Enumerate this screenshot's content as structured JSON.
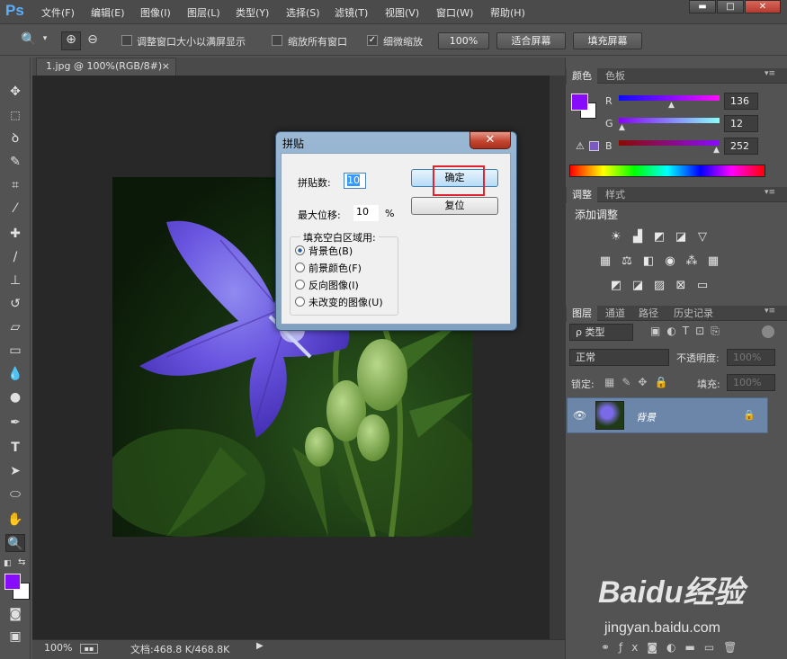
{
  "app": {
    "logo": "Ps"
  },
  "menus": [
    "文件(F)",
    "编辑(E)",
    "图像(I)",
    "图层(L)",
    "类型(Y)",
    "选择(S)",
    "滤镜(T)",
    "视图(V)",
    "窗口(W)",
    "帮助(H)"
  ],
  "window_controls": {
    "minimize": "▬",
    "maximize": "□",
    "close": "✕"
  },
  "options": {
    "resize_windows": "调整窗口大小以满屏显示",
    "zoom_all": "缩放所有窗口",
    "scrubby_zoom": "细微缩放",
    "scrubby_checked": "✓",
    "zoom_100": "100%",
    "fit_screen": "适合屏幕",
    "fill_screen": "填充屏幕"
  },
  "document": {
    "tab_title": "1.jpg @ 100%(RGB/8#)",
    "tab_close": "×"
  },
  "status": {
    "zoom": "100%",
    "doc_size": "文档:468.8 K/468.8K"
  },
  "dialog": {
    "title": "拼贴",
    "close": "✕",
    "tiles_label": "拼贴数:",
    "tiles_value": "10",
    "offset_label": "最大位移:",
    "offset_value": "10",
    "offset_unit": "%",
    "group_label": "填充空白区域用:",
    "options": [
      "背景色(B)",
      "前景颜色(F)",
      "反向图像(I)",
      "未改变的图像(U)"
    ],
    "selected_index": 0,
    "ok": "确定",
    "reset": "复位"
  },
  "color_panel": {
    "tabs": [
      "颜色",
      "色板"
    ],
    "channels": [
      {
        "label": "R",
        "value": "136"
      },
      {
        "label": "G",
        "value": "12"
      },
      {
        "label": "B",
        "value": "252"
      }
    ],
    "fg_color": "#880cfc"
  },
  "adjust_panel": {
    "tabs": [
      "调整",
      "样式"
    ],
    "add_label": "添加调整"
  },
  "layers_panel": {
    "tabs": [
      "图层",
      "通道",
      "路径",
      "历史记录"
    ],
    "filter_label": "ρ 类型",
    "blend_mode": "正常",
    "opacity_label": "不透明度:",
    "opacity_value": "100%",
    "lock_label": "锁定:",
    "fill_label": "填充:",
    "fill_value": "100%",
    "layer_name": "背景"
  },
  "watermark": {
    "brand": "Baidu经验",
    "url": "jingyan.baidu.com"
  }
}
